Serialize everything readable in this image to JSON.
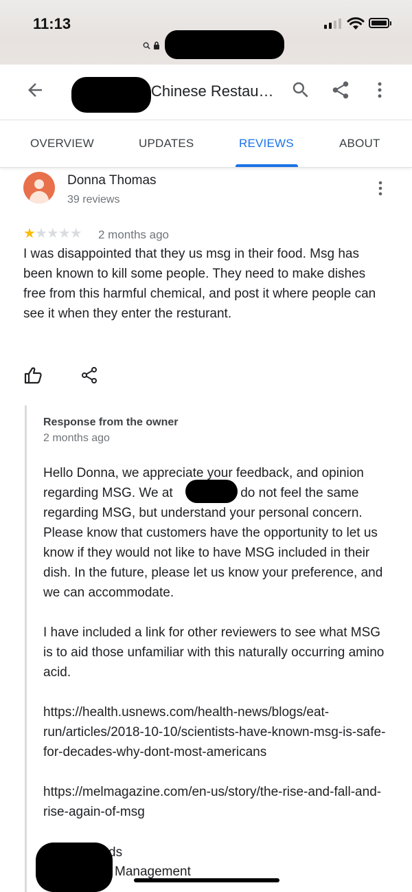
{
  "status": {
    "time": "11:13"
  },
  "appbar": {
    "title_visible": "Chinese Restau…"
  },
  "tabs": [
    {
      "label": "OVERVIEW"
    },
    {
      "label": "UPDATES"
    },
    {
      "label": "REVIEWS",
      "active": true
    },
    {
      "label": "ABOUT"
    }
  ],
  "review": {
    "author": "Donna Thomas",
    "author_reviews": "39 reviews",
    "rating": 1,
    "rating_max": 5,
    "date": "2 months ago",
    "text": "I was disappointed that they us msg in their food. Msg has been known to kill some people. They need to make dishes free from this harmful chemical, and post it where people can see it when they enter the resturant."
  },
  "response": {
    "title": "Response from the owner",
    "date": "2 months ago",
    "p1_a": "Hello Donna, we appreciate your feedback, and opinion regarding MSG. We at ",
    "p1_b": " do not feel the same regarding MSG, but understand your personal concern. Please know that customers have the opportunity to let us know if they would not like to have MSG included in their dish. In the future, please let us know your preference, and we can accommodate.",
    "p2": "I have included a link for other reviewers to see what MSG is to aid those unfamiliar with this naturally occurring amino acid.",
    "link1": "https://health.usnews.com/health-news/blogs/eat-run/articles/2018-10-10/scientists-have-known-msg-is-safe-for-decades-why-dont-most-americans",
    "link2": "https://melmagazine.com/en-us/story/the-rise-and-fall-and-rise-again-of-msg",
    "closing": "Kind Regards",
    "signature": "Management"
  },
  "colors": {
    "accent": "#1a73e8",
    "star": "#fbbc04",
    "avatar": "#e8704b"
  },
  "icons": [
    "back-arrow-icon",
    "search-icon",
    "share-icon",
    "more-vert-icon",
    "thumbs-up-icon",
    "lock-icon"
  ]
}
